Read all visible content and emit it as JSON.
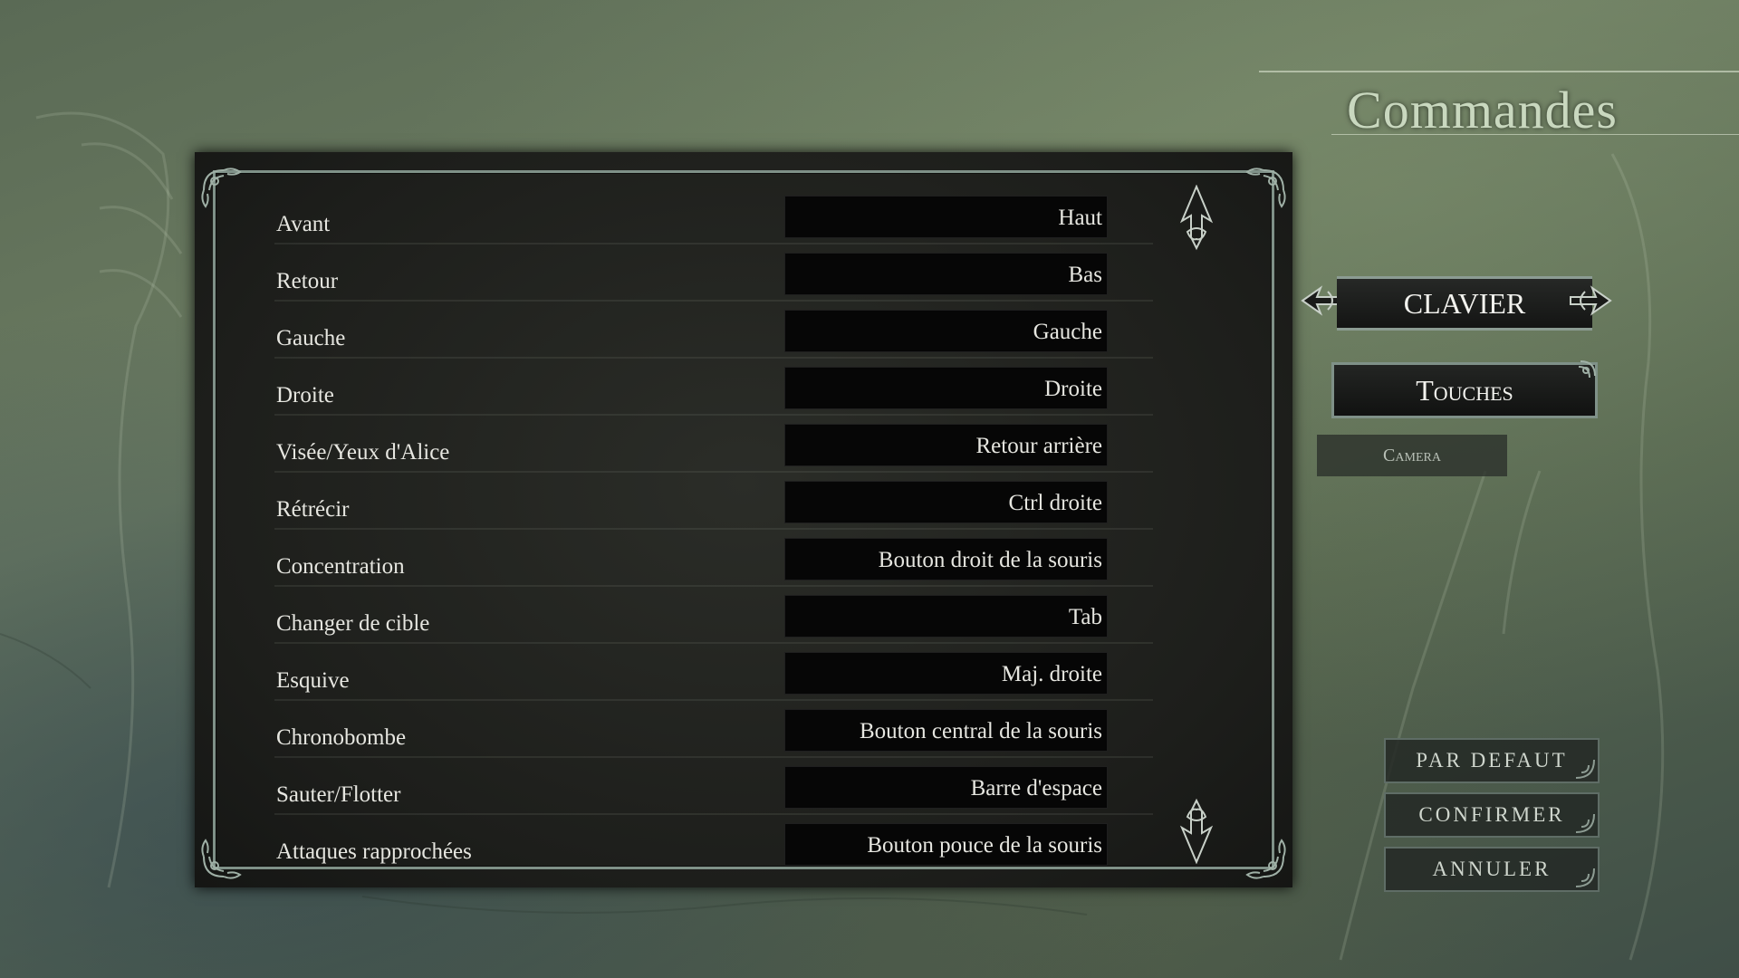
{
  "screen": {
    "title": "Commandes"
  },
  "bindings": [
    {
      "action": "Avant",
      "key": "Haut"
    },
    {
      "action": "Retour",
      "key": "Bas"
    },
    {
      "action": "Gauche",
      "key": "Gauche"
    },
    {
      "action": "Droite",
      "key": "Droite"
    },
    {
      "action": "Visée/Yeux d'Alice",
      "key": "Retour arrière"
    },
    {
      "action": "Rétrécir",
      "key": "Ctrl droite"
    },
    {
      "action": "Concentration",
      "key": "Bouton droit de la souris"
    },
    {
      "action": "Changer de cible",
      "key": "Tab"
    },
    {
      "action": "Esquive",
      "key": "Maj. droite"
    },
    {
      "action": "Chronobombe",
      "key": "Bouton central de la souris"
    },
    {
      "action": "Sauter/Flotter",
      "key": "Barre d'espace"
    },
    {
      "action": "Attaques rapprochées",
      "key": "Bouton pouce de la souris"
    }
  ],
  "sidebar": {
    "device_label": "Clavier",
    "tab_keys": "Touches",
    "tab_camera": "Camera"
  },
  "actions": {
    "default": "PAR DEFAUT",
    "confirm": "CONFIRMER",
    "cancel": "ANNULER"
  },
  "colors": {
    "panel": "#1d1e1b",
    "frame": "#7f9188",
    "text": "#e6e6e0",
    "title": "#c9d8bf"
  },
  "icons": [
    "ornate-arrow-up-icon",
    "ornate-arrow-down-icon",
    "ornate-arrow-left-icon",
    "ornate-arrow-right-icon",
    "corner-flourish-icon"
  ]
}
